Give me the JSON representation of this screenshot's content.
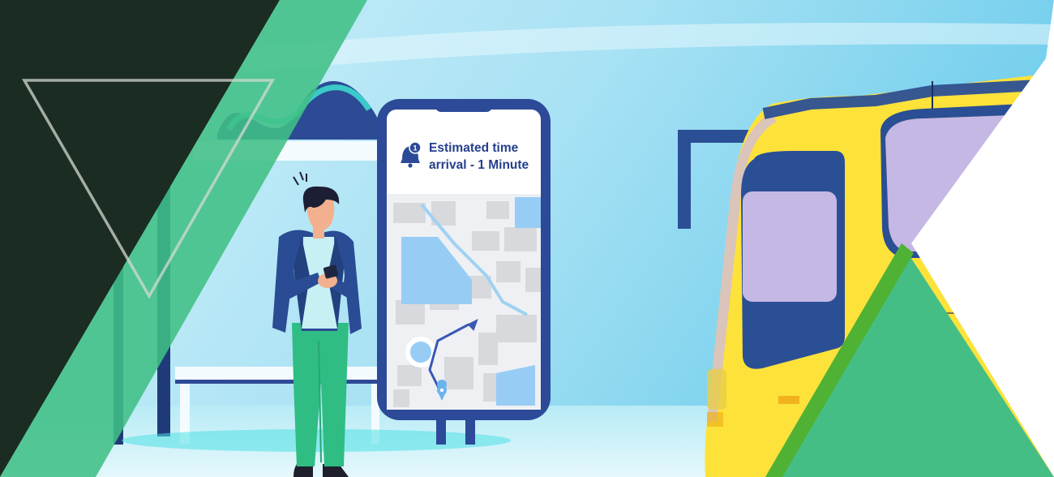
{
  "notification": {
    "badge_count": "1",
    "line1": "Estimated time",
    "line2": "arrival - 1 Minute"
  },
  "colors": {
    "sky_light": "#c8ecf7",
    "sky_deep": "#8ed6ef",
    "dark_green": "#1b2d22",
    "accent_green": "#40bf85",
    "phone_frame": "#2c4a98",
    "bus_yellow": "#fde23a",
    "bus_navy": "#2b4f95",
    "bus_window": "#c5b8e4",
    "map_water": "#97cdf5",
    "map_block": "#d8d9dd",
    "route": "#3a57b5"
  },
  "icons": {
    "notification": "bell-icon",
    "destination": "location-pin-icon",
    "direction": "arrow-icon"
  }
}
